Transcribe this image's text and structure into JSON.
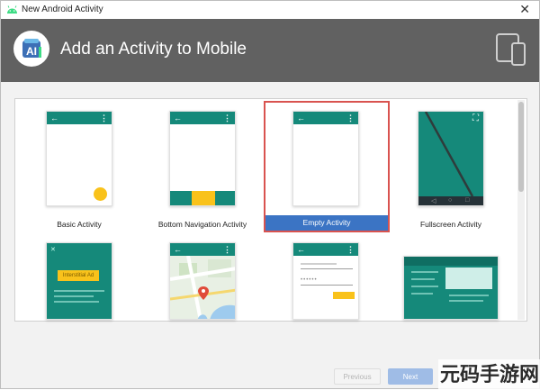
{
  "window": {
    "title": "New Android Activity",
    "close_symbol": "✕"
  },
  "header": {
    "heading": "Add an Activity to Mobile"
  },
  "gallery": {
    "tiles": [
      {
        "label": "Basic Activity"
      },
      {
        "label": "Bottom Navigation Activity"
      },
      {
        "label": "Empty Activity",
        "selected": true
      },
      {
        "label": "Fullscreen Activity"
      },
      {
        "label": "",
        "preview_text": "Interstitial Ad"
      },
      {
        "label": ""
      },
      {
        "label": ""
      },
      {
        "label": ""
      }
    ]
  },
  "footer": {
    "previous_label": "Previous",
    "next_label": "Next"
  },
  "watermark": {
    "text": "元码手游网"
  },
  "colors": {
    "header": "#616161",
    "teal": "#15897a",
    "accent_yellow": "#f9c21b",
    "selection_blue": "#3b74c4",
    "selection_border": "#d9534f"
  }
}
